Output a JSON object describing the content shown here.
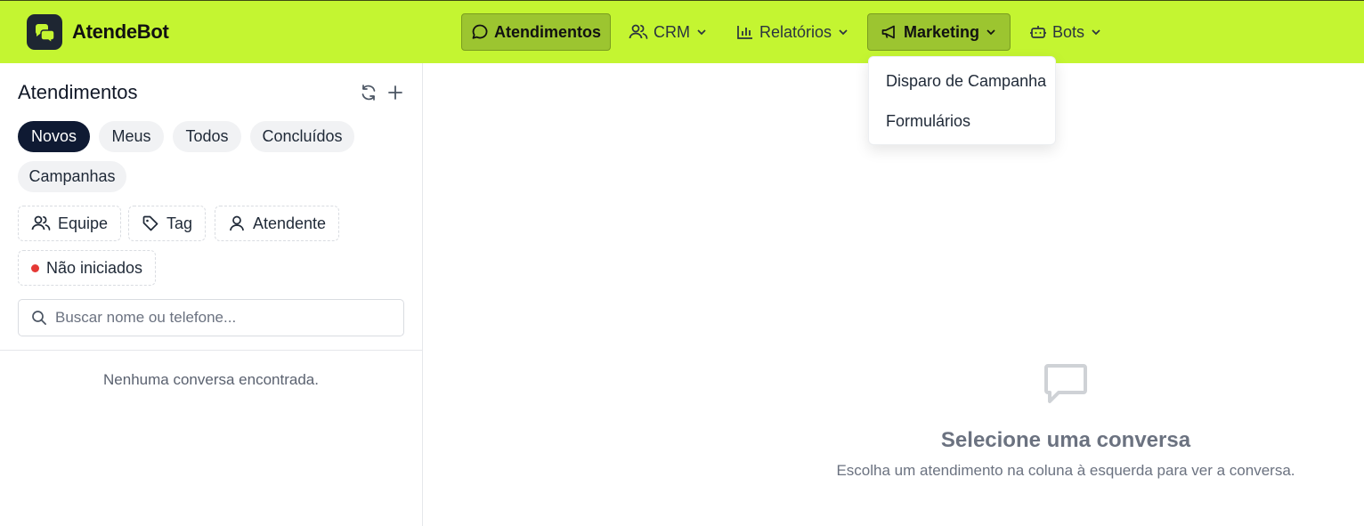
{
  "app": {
    "name": "AtendeBot",
    "accent": "#c4f531",
    "logo_icon": "chat-bubbles-logo"
  },
  "nav": {
    "atendimentos": {
      "label": "Atendimentos",
      "icon": "chat-bubble-icon",
      "active": true
    },
    "crm": {
      "label": "CRM",
      "icon": "users-icon"
    },
    "relatorios": {
      "label": "Relatórios",
      "icon": "bar-chart-icon"
    },
    "marketing": {
      "label": "Marketing",
      "icon": "megaphone-icon",
      "open": true
    },
    "bots": {
      "label": "Bots",
      "icon": "bot-icon"
    }
  },
  "marketing_menu": {
    "items": [
      "Disparo de Campanha",
      "Formulários"
    ]
  },
  "sidebar": {
    "title": "Atendimentos",
    "tabs": [
      {
        "label": "Novos",
        "active": true
      },
      {
        "label": "Meus"
      },
      {
        "label": "Todos"
      },
      {
        "label": "Concluídos"
      },
      {
        "label": "Campanhas"
      }
    ],
    "filters": {
      "equipe": "Equipe",
      "tag": "Tag",
      "atendente": "Atendente",
      "nao_iniciados": "Não iniciados"
    },
    "search_placeholder": "Buscar nome ou telefone...",
    "empty_message": "Nenhuma conversa encontrada."
  },
  "main": {
    "empty_title": "Selecione uma conversa",
    "empty_subtitle": "Escolha um atendimento na coluna à esquerda para ver a conversa."
  }
}
